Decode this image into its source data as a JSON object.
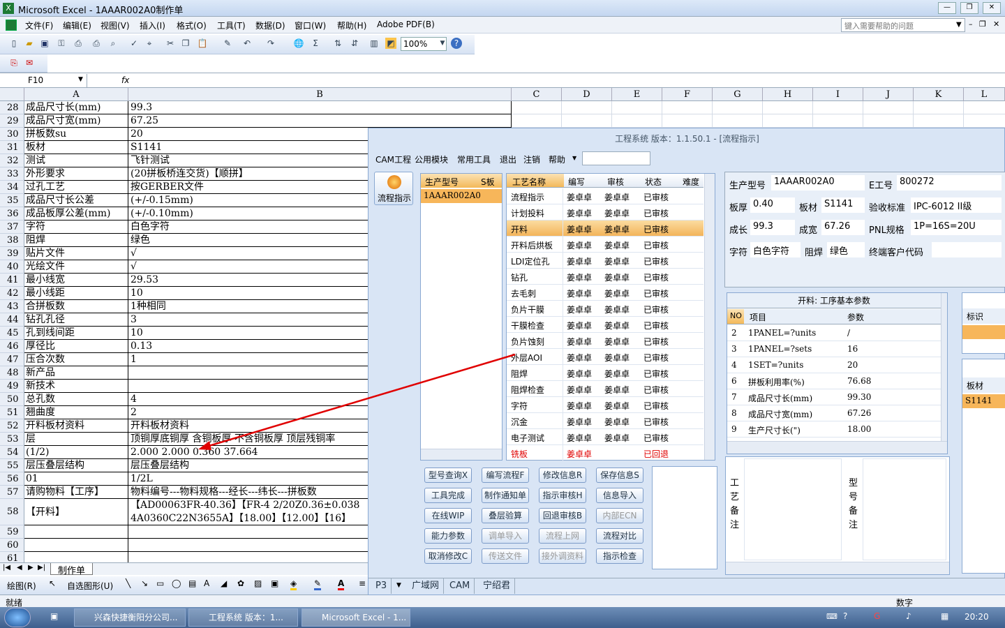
{
  "excel": {
    "title": "Microsoft Excel - 1AAAR002A0制作单",
    "menu": [
      "文件(F)",
      "编辑(E)",
      "视图(V)",
      "插入(I)",
      "格式(O)",
      "工具(T)",
      "数据(D)",
      "窗口(W)",
      "帮助(H)",
      "Adobe PDF(B)"
    ],
    "help_placeholder": "键入需要帮助的问题",
    "zoom": "100%",
    "cell_ref": "F10",
    "fx": "fx",
    "columns": [
      "A",
      "B",
      "C",
      "D",
      "E",
      "F",
      "G",
      "H",
      "I",
      "J",
      "K",
      "L"
    ],
    "rows": [
      {
        "n": "28",
        "a": "成品尺寸长(mm)",
        "b": "99.3"
      },
      {
        "n": "29",
        "a": "成品尺寸宽(mm)",
        "b": "67.25"
      },
      {
        "n": "30",
        "a": "拼板数su",
        "b": "20"
      },
      {
        "n": "31",
        "a": "板材",
        "b": "S1141"
      },
      {
        "n": "32",
        "a": "测试",
        "b": "飞针测试"
      },
      {
        "n": "33",
        "a": "外形要求",
        "b": "(20拼板桥连交货)【顺拼】"
      },
      {
        "n": "34",
        "a": "过孔工艺",
        "b": "按GERBER文件"
      },
      {
        "n": "35",
        "a": "成品尺寸长公差",
        "b": "(+/-0.15mm)"
      },
      {
        "n": "36",
        "a": "成品板厚公差(mm)",
        "b": "(+/-0.10mm)"
      },
      {
        "n": "37",
        "a": "字符",
        "b": "白色字符"
      },
      {
        "n": "38",
        "a": "阻焊",
        "b": "绿色"
      },
      {
        "n": "39",
        "a": "贴片文件",
        "b": "√"
      },
      {
        "n": "40",
        "a": "光绘文件",
        "b": "√"
      },
      {
        "n": "41",
        "a": "最小线宽",
        "b": "29.53"
      },
      {
        "n": "42",
        "a": "最小线距",
        "b": "10"
      },
      {
        "n": "43",
        "a": "合拼板数",
        "b": "1种相同"
      },
      {
        "n": "44",
        "a": "钻孔孔径",
        "b": "3"
      },
      {
        "n": "45",
        "a": "孔到线间距",
        "b": "10"
      },
      {
        "n": "46",
        "a": "厚径比",
        "b": "0.13"
      },
      {
        "n": "47",
        "a": "压合次数",
        "b": "1"
      },
      {
        "n": "48",
        "a": "新产品",
        "b": ""
      },
      {
        "n": "49",
        "a": "新技术",
        "b": ""
      },
      {
        "n": "50",
        "a": "总孔数",
        "b": "4"
      },
      {
        "n": "51",
        "a": "翘曲度",
        "b": "2"
      },
      {
        "n": "52",
        "a": "开料板材资料",
        "b": "开料板材资料"
      },
      {
        "n": "53",
        "a": "层",
        "b": "顶铜厚底铜厚 含铜板厚 不含铜板厚 顶层残铜率"
      },
      {
        "n": "54",
        "a": "(1/2)",
        "b": "2.000  2.000          0.360        37.664"
      },
      {
        "n": "55",
        "a": "层压叠层结构",
        "b": "层压叠层结构"
      },
      {
        "n": "56",
        "a": "01",
        "b": "1/2L"
      },
      {
        "n": "57",
        "a": "请购物料【工序】",
        "b": "物料编号---物料规格---经长---纬长---拼板数"
      },
      {
        "n": "58",
        "a": "【开料】",
        "b": "【AD00063FR-40.36】【FR-4 2/20Z0.36±0.038",
        "b2": "4A0360C22N3655A】【18.00】【12.00】【16】"
      },
      {
        "n": "59",
        "a": "",
        "b": ""
      },
      {
        "n": "60",
        "a": "",
        "b": ""
      },
      {
        "n": "61",
        "a": "",
        "b": ""
      }
    ],
    "sheet_tab": "制作单",
    "draw_label": "绘图(R)",
    "autoshape_label": "自选图形(U)",
    "status_left": "就绪",
    "status_right": "数字"
  },
  "taskbar": {
    "items": [
      "兴森快捷衡阳分公司...",
      "工程系统 版本：1...",
      "Microsoft Excel - 1..."
    ],
    "clock": "20:20"
  },
  "app": {
    "title": "工程系统  版本：1.1.50.1 - [流程指示]",
    "menu": [
      "CAM工程",
      "公用模块",
      "常用工具",
      "退出",
      "注销",
      "帮助"
    ],
    "side_button": "流程指示",
    "model_list": {
      "headers": [
        "生产型号",
        "S板"
      ],
      "items": [
        "1AAAR002A0"
      ]
    },
    "flow_headers": [
      "工艺名称",
      "编写",
      "审核",
      "状态",
      "难度"
    ],
    "flow_rows": [
      {
        "name": "流程指示",
        "writer": "姜卓卓",
        "reviewer": "姜卓卓",
        "status": "已审核"
      },
      {
        "name": "计划投料",
        "writer": "姜卓卓",
        "reviewer": "姜卓卓",
        "status": "已审核"
      },
      {
        "name": "开料",
        "writer": "姜卓卓",
        "reviewer": "姜卓卓",
        "status": "已审核"
      },
      {
        "name": "开料后烘板",
        "writer": "姜卓卓",
        "reviewer": "姜卓卓",
        "status": "已审核"
      },
      {
        "name": "LDI定位孔",
        "writer": "姜卓卓",
        "reviewer": "姜卓卓",
        "status": "已审核"
      },
      {
        "name": "钻孔",
        "writer": "姜卓卓",
        "reviewer": "姜卓卓",
        "status": "已审核"
      },
      {
        "name": "去毛刺",
        "writer": "姜卓卓",
        "reviewer": "姜卓卓",
        "status": "已审核"
      },
      {
        "name": "负片干膜",
        "writer": "姜卓卓",
        "reviewer": "姜卓卓",
        "status": "已审核"
      },
      {
        "name": "干膜检查",
        "writer": "姜卓卓",
        "reviewer": "姜卓卓",
        "status": "已审核"
      },
      {
        "name": "负片蚀刻",
        "writer": "姜卓卓",
        "reviewer": "姜卓卓",
        "status": "已审核"
      },
      {
        "name": "外层AOI",
        "writer": "姜卓卓",
        "reviewer": "姜卓卓",
        "status": "已审核"
      },
      {
        "name": "阻焊",
        "writer": "姜卓卓",
        "reviewer": "姜卓卓",
        "status": "已审核"
      },
      {
        "name": "阻焊检查",
        "writer": "姜卓卓",
        "reviewer": "姜卓卓",
        "status": "已审核"
      },
      {
        "name": "字符",
        "writer": "姜卓卓",
        "reviewer": "姜卓卓",
        "status": "已审核"
      },
      {
        "name": "沉金",
        "writer": "姜卓卓",
        "reviewer": "姜卓卓",
        "status": "已审核"
      },
      {
        "name": "电子测试",
        "writer": "姜卓卓",
        "reviewer": "姜卓卓",
        "status": "已审核"
      },
      {
        "name": "铣板",
        "writer": "姜卓卓",
        "reviewer": "",
        "status": "已回退"
      }
    ],
    "buttons": [
      [
        "型号查询X",
        "编写流程F",
        "修改信息R",
        "保存信息S"
      ],
      [
        "工具完成",
        "制作通知单",
        "指示审核H",
        "信息导入"
      ],
      [
        "在线WIP",
        "叠层验算",
        "回退审核B",
        "内部ECN"
      ],
      [
        "能力参数",
        "调单导入",
        "流程上网",
        "流程对比"
      ],
      [
        "取消修改C",
        "传送文件",
        "接外调资料",
        "指示检查"
      ]
    ],
    "disabled_buttons": [
      "内部ECN",
      "调单导入",
      "流程上网",
      "传送文件",
      "接外调资料"
    ],
    "info": {
      "prod_model_label": "生产型号",
      "prod_model": "1AAAR002A0",
      "e_no_label": "E工号",
      "e_no": "800272",
      "thick_label": "板厚",
      "thick": "0.40",
      "material_label": "板材",
      "material": "S1141",
      "std_label": "验收标准",
      "std": "IPC-6012 II级",
      "len_label": "成长",
      "len": "99.3",
      "width_label": "成宽",
      "width": "67.26",
      "pnl_label": "PNL规格",
      "pnl": "1P=16S=20U",
      "char_label": "字符",
      "char": "白色字符",
      "mask_label": "阻焊",
      "mask": "绿色",
      "cust_label": "终端客户代码",
      "cust": ""
    },
    "params": {
      "title": "开料: 工序基本参数",
      "headers": [
        "NO",
        "项目",
        "参数"
      ],
      "rows": [
        {
          "no": "2",
          "item": "1PANEL=?units",
          "val": "/"
        },
        {
          "no": "3",
          "item": "1PANEL=?sets",
          "val": "16"
        },
        {
          "no": "4",
          "item": "1SET=?units",
          "val": "20"
        },
        {
          "no": "6",
          "item": "拼板利用率(%)",
          "val": "76.68"
        },
        {
          "no": "7",
          "item": "成品尺寸长(mm)",
          "val": "99.30"
        },
        {
          "no": "8",
          "item": "成品尺寸宽(mm)",
          "val": "67.26"
        },
        {
          "no": "9",
          "item": "生产尺寸长(\")",
          "val": "18.00"
        }
      ]
    },
    "right_mini": {
      "h1": "标识",
      "h2": "板材",
      "v2": "S1141"
    },
    "notes": {
      "process": "工艺备注",
      "model": "型号备注"
    },
    "footer_tabs": [
      "P3",
      "广域网",
      "CAM",
      "宁绍君"
    ]
  },
  "colors": {
    "accent": "#f7b65a",
    "red": "#e00000",
    "app_bg": "#d9e5f5"
  }
}
